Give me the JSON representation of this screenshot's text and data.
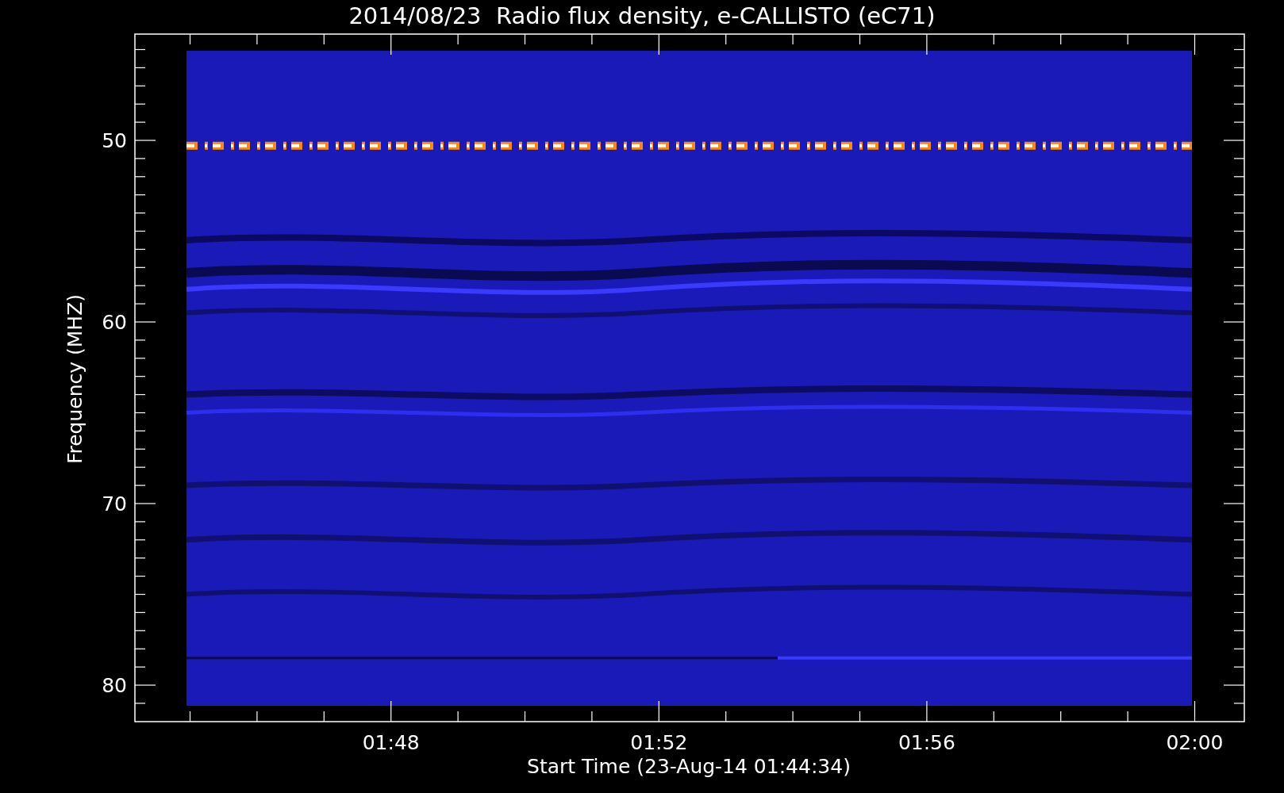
{
  "title": "2014/08/23  Radio flux density, e-CALLISTO (eC71)",
  "y_axis": {
    "label": "Frequency (MHZ)",
    "ticks": [
      "50",
      "60",
      "70",
      "80"
    ]
  },
  "x_axis": {
    "label": "Start Time (23-Aug-14 01:44:34)",
    "ticks": [
      "01:48",
      "01:52",
      "01:56",
      "02:00"
    ]
  }
}
